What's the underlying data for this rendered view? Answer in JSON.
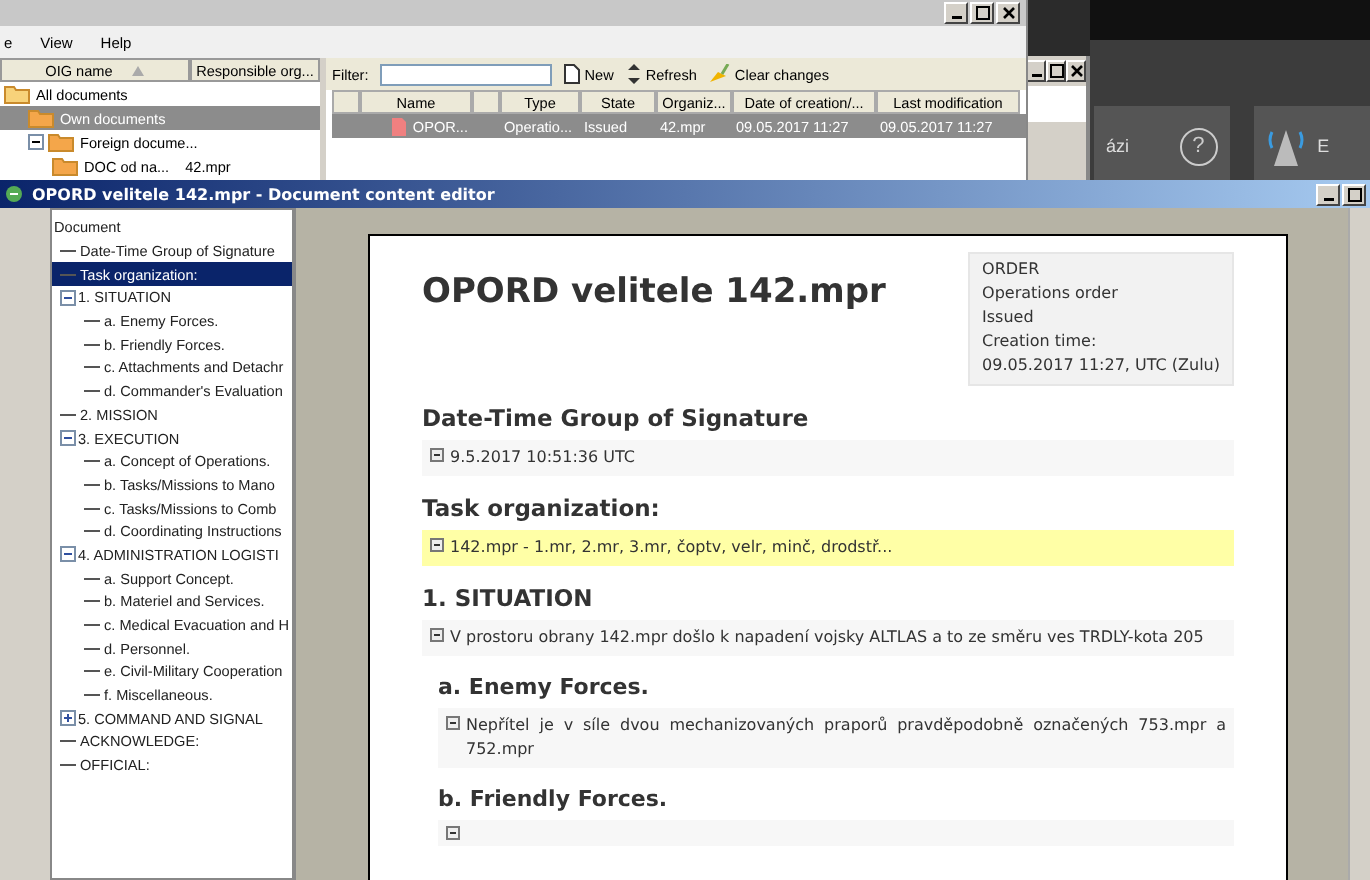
{
  "back_window": {
    "menu": [
      "e",
      "View",
      "Help"
    ],
    "tree_columns": [
      {
        "label": "OIG name",
        "sorted": true
      },
      {
        "label": "Responsible org...",
        "sorted": false
      }
    ],
    "tree": [
      {
        "label": "All documents",
        "selected": false,
        "children": [
          {
            "label": "Own documents",
            "selected": true
          },
          {
            "label": "Foreign docume...",
            "selected": false,
            "expanded": true,
            "children": [
              {
                "label": "DOC od na...",
                "org": "42.mpr",
                "selected": false
              }
            ]
          }
        ]
      }
    ],
    "filter": {
      "label": "Filter:"
    },
    "toolbar": [
      {
        "kind": "new",
        "label": "New"
      },
      {
        "kind": "refresh",
        "label": "Refresh"
      },
      {
        "kind": "clear",
        "label": "Clear changes"
      }
    ],
    "table": {
      "columns": [
        "",
        "Name",
        "",
        "Type",
        "State",
        "Organiz...",
        "Date of creation/...",
        "Last modification"
      ],
      "rows": [
        {
          "selected": true,
          "cells": [
            "",
            "OPOR...",
            "",
            "Operatio...",
            "Issued",
            "42.mpr",
            "09.05.2017 11:27",
            "09.05.2017 11:27"
          ]
        }
      ]
    }
  },
  "side_app": {
    "tiles": [
      {
        "kind": "help",
        "label": "ázi",
        "icon": "?"
      },
      {
        "kind": "antenna",
        "label": "E"
      }
    ]
  },
  "editor": {
    "title": "OPORD velitele 142.mpr - Document content editor",
    "outline": [
      {
        "label": "Document",
        "selected": false,
        "children": [
          {
            "label": "Date-Time Group of Signature",
            "selected": false
          },
          {
            "label": "Task organization:",
            "selected": true
          },
          {
            "label": "1. SITUATION",
            "selected": false,
            "expanded": true,
            "children": [
              {
                "label": "a. Enemy Forces.",
                "selected": false
              },
              {
                "label": "b. Friendly Forces.",
                "selected": false
              },
              {
                "label": "c. Attachments and Detachr",
                "selected": false
              },
              {
                "label": "d. Commander's Evaluation",
                "selected": false
              }
            ]
          },
          {
            "label": "2. MISSION",
            "selected": false
          },
          {
            "label": "3. EXECUTION",
            "selected": false,
            "expanded": true,
            "children": [
              {
                "label": "a. Concept of Operations.",
                "selected": false
              },
              {
                "label": "b. Tasks/Missions to Mano",
                "selected": false
              },
              {
                "label": "c. Tasks/Missions to Comb",
                "selected": false
              },
              {
                "label": "d. Coordinating Instructions",
                "selected": false
              }
            ]
          },
          {
            "label": "4. ADMINISTRATION LOGISTI",
            "selected": false,
            "expanded": true,
            "children": [
              {
                "label": "a. Support Concept.",
                "selected": false
              },
              {
                "label": "b. Materiel and Services.",
                "selected": false
              },
              {
                "label": "c. Medical Evacuation and H",
                "selected": false
              },
              {
                "label": "d. Personnel.",
                "selected": false
              },
              {
                "label": "e. Civil-Military Cooperation",
                "selected": false
              },
              {
                "label": "f. Miscellaneous.",
                "selected": false
              }
            ]
          },
          {
            "label": "5. COMMAND AND SIGNAL",
            "selected": false,
            "expanded": false
          },
          {
            "label": "ACKNOWLEDGE:",
            "selected": false
          },
          {
            "label": "OFFICIAL:",
            "selected": false
          }
        ]
      }
    ],
    "document": {
      "title": "OPORD velitele 142.mpr",
      "info": [
        "ORDER",
        "Operations order",
        "Issued",
        "Creation time:",
        "09.05.2017 11:27, UTC (Zulu)"
      ],
      "sections": [
        {
          "kind": "section",
          "heading": "Date-Time Group of Signature",
          "text": "9.5.2017 10:51:36 UTC",
          "highlighted": false
        },
        {
          "kind": "section",
          "heading": "Task organization:",
          "text": "142.mpr - 1.mr, 2.mr, 3.mr, čoptv, velr, minč, drodstř...",
          "highlighted": true
        },
        {
          "kind": "section",
          "heading": "1. SITUATION",
          "text": "V prostoru obrany 142.mpr došlo k napadení vojsky ALTLAS a to ze směru ves TRDLY-kota 205",
          "highlighted": false
        },
        {
          "kind": "subsection",
          "heading": "a. Enemy Forces.",
          "text": "Nepřítel je v síle dvou mechanizovaných praporů pravděpodobně označených 753.mpr a 752.mpr",
          "highlighted": false
        },
        {
          "kind": "subsection",
          "heading": "b. Friendly Forces.",
          "highlighted": false
        }
      ]
    }
  }
}
